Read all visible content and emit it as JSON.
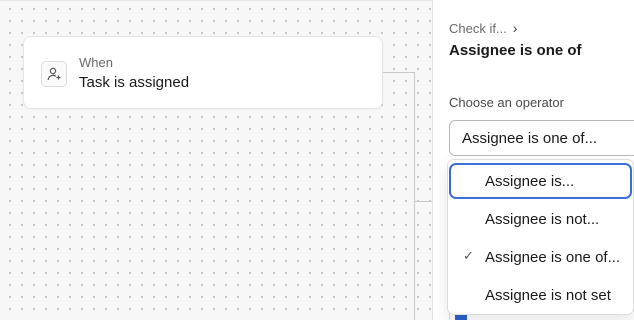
{
  "trigger": {
    "kicker": "When",
    "title": "Task is assigned",
    "icon": "user-plus-icon"
  },
  "panel": {
    "breadcrumb": "Check if...",
    "breadcrumb_icon": "chevron-right-icon",
    "title": "Assignee is one of",
    "operator_label": "Choose an operator",
    "operator_value": "Assignee is one of..."
  },
  "dropdown": {
    "options": [
      {
        "label": "Assignee is...",
        "focused": true,
        "selected": false
      },
      {
        "label": "Assignee is not...",
        "focused": false,
        "selected": false
      },
      {
        "label": "Assignee is one of...",
        "focused": false,
        "selected": true
      },
      {
        "label": "Assignee is not set",
        "focused": false,
        "selected": false
      }
    ],
    "check_icon": "checkmark-icon"
  },
  "colors": {
    "accent": "#3a6fd8",
    "canvas_bg": "#f7f7f7"
  }
}
